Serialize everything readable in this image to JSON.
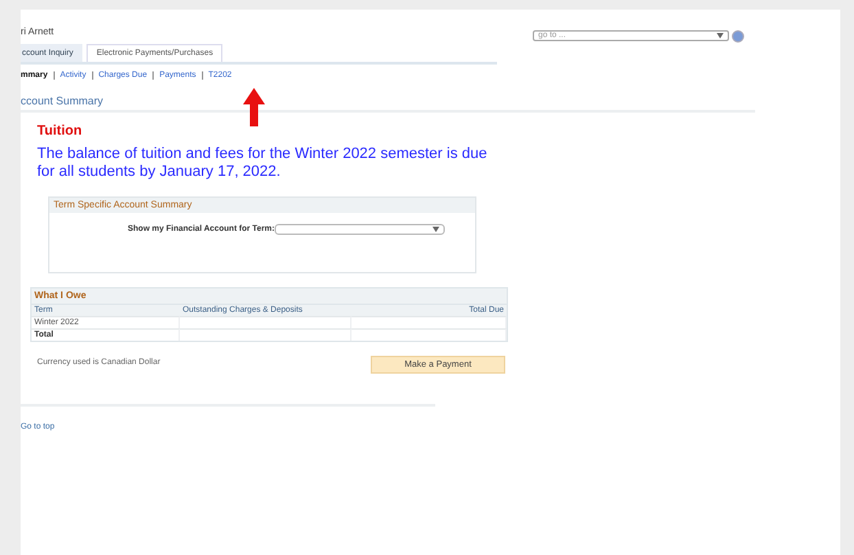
{
  "header": {
    "name": "ri Arnett",
    "goto": {
      "placeholder": "go to ..."
    }
  },
  "tabs": [
    {
      "label": "ccount Inquiry",
      "selected": true
    },
    {
      "label": "Electronic Payments/Purchases",
      "selected": false
    }
  ],
  "subnav": [
    {
      "label": "mmary",
      "selected": true
    },
    {
      "label": "Activity",
      "selected": false
    },
    {
      "label": "Charges Due",
      "selected": false
    },
    {
      "label": "Payments",
      "selected": false
    },
    {
      "label": "T2202",
      "selected": false
    }
  ],
  "page_title": "ccount Summary",
  "notice": {
    "title": "Tuition",
    "text": "The balance of tuition and fees for the Winter 2022 semester is due for all students by January 17, 2022."
  },
  "term_box": {
    "title": "Term Specific Account Summary",
    "label": "Show my Financial Account for Term:"
  },
  "owe_table": {
    "title": "What I Owe",
    "columns": [
      "Term",
      "Outstanding Charges & Deposits",
      "Total Due"
    ],
    "rows": [
      {
        "kind": "term",
        "term": "Winter 2022"
      },
      {
        "kind": "total",
        "term": "Total"
      }
    ]
  },
  "currency_note": "Currency used is Canadian Dollar",
  "pay_button": "Make a Payment",
  "go_to_top": "Go to top"
}
